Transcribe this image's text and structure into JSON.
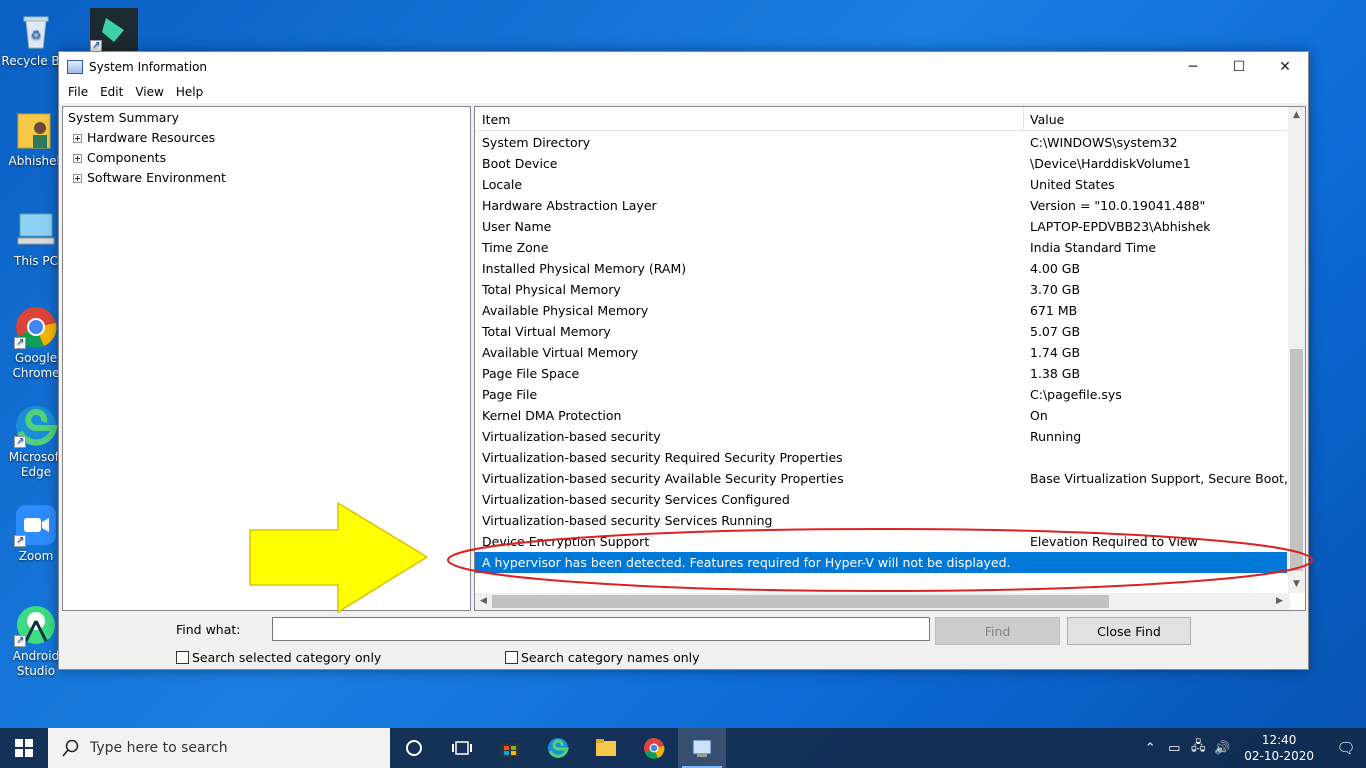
{
  "desktop": {
    "icons": [
      {
        "label": "Recycle Bin",
        "icon": "recycle-bin-icon"
      },
      {
        "label": "Filmora",
        "icon": "filmora-icon"
      },
      {
        "label": "Abhishek",
        "icon": "user-folder-icon"
      },
      {
        "label": "This PC",
        "icon": "this-pc-icon"
      },
      {
        "label": "Google Chrome",
        "icon": "chrome-icon"
      },
      {
        "label": "Microsoft Edge",
        "icon": "edge-icon"
      },
      {
        "label": "Zoom",
        "icon": "zoom-icon"
      },
      {
        "label": "Android Studio",
        "icon": "android-studio-icon"
      }
    ]
  },
  "window": {
    "title": "System Information",
    "controls": {
      "minimize": "─",
      "maximize": "☐",
      "close": "✕"
    },
    "menu": [
      "File",
      "Edit",
      "View",
      "Help"
    ]
  },
  "tree": {
    "root": "System Summary",
    "children": [
      "Hardware Resources",
      "Components",
      "Software Environment"
    ]
  },
  "list": {
    "headers": {
      "item": "Item",
      "value": "Value"
    },
    "rows": [
      {
        "item": "System Directory",
        "value": "C:\\WINDOWS\\system32"
      },
      {
        "item": "Boot Device",
        "value": "\\Device\\HarddiskVolume1"
      },
      {
        "item": "Locale",
        "value": "United States"
      },
      {
        "item": "Hardware Abstraction Layer",
        "value": "Version = \"10.0.19041.488\""
      },
      {
        "item": "User Name",
        "value": "LAPTOP-EPDVBB23\\Abhishek"
      },
      {
        "item": "Time Zone",
        "value": "India Standard Time"
      },
      {
        "item": "Installed Physical Memory (RAM)",
        "value": "4.00 GB"
      },
      {
        "item": "Total Physical Memory",
        "value": "3.70 GB"
      },
      {
        "item": "Available Physical Memory",
        "value": "671 MB"
      },
      {
        "item": "Total Virtual Memory",
        "value": "5.07 GB"
      },
      {
        "item": "Available Virtual Memory",
        "value": "1.74 GB"
      },
      {
        "item": "Page File Space",
        "value": "1.38 GB"
      },
      {
        "item": "Page File",
        "value": "C:\\pagefile.sys"
      },
      {
        "item": "Kernel DMA Protection",
        "value": "On"
      },
      {
        "item": "Virtualization-based security",
        "value": "Running"
      },
      {
        "item": "Virtualization-based security Required Security Properties",
        "value": ""
      },
      {
        "item": "Virtualization-based security Available Security Properties",
        "value": "Base Virtualization Support, Secure Boot, DMA Protection"
      },
      {
        "item": "Virtualization-based security Services Configured",
        "value": ""
      },
      {
        "item": "Virtualization-based security Services Running",
        "value": ""
      },
      {
        "item": "Device Encryption Support",
        "value": "Elevation Required to View"
      }
    ],
    "selected_row": "A hypervisor has been detected. Features required for Hyper-V will not be displayed."
  },
  "find": {
    "label": "Find what:",
    "value": "",
    "find_button": "Find",
    "close_button": "Close Find",
    "check_selected": "Search selected category only",
    "check_names": "Search category names only"
  },
  "taskbar": {
    "search_placeholder": "Type here to search",
    "time": "12:40",
    "date": "02-10-2020"
  },
  "colors": {
    "selection": "#0078d7",
    "annotation_ellipse": "#e02020",
    "annotation_arrow": "#ffff00"
  }
}
